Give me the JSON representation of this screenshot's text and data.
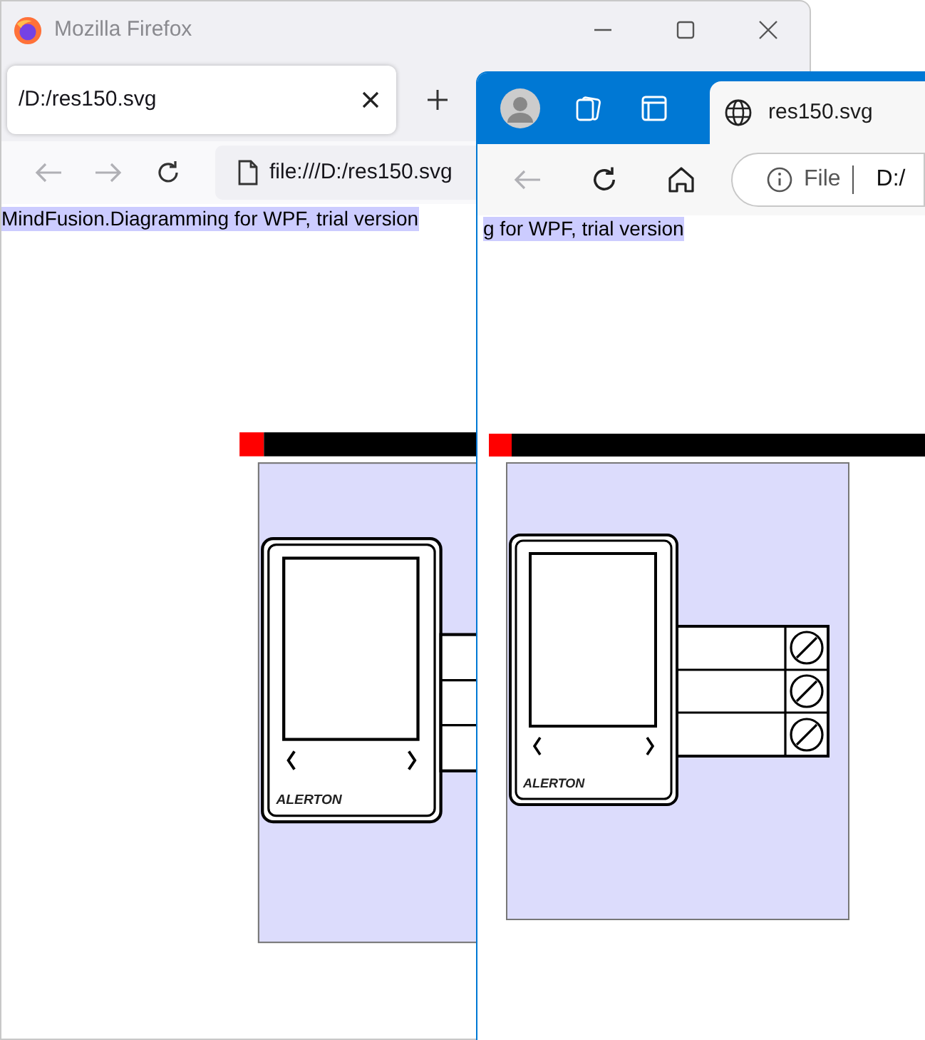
{
  "firefox": {
    "title": "Mozilla Firefox",
    "tabs": [
      {
        "label": "/D:/res150.svg",
        "selected": true
      }
    ],
    "back_disabled": true,
    "forward_disabled": true,
    "address": "file:///D:/res150.svg",
    "banner": "MindFusion.Diagramming for WPF, trial version",
    "device_logo": "ALERTON"
  },
  "edge": {
    "tabs": [
      {
        "label": "res150.svg",
        "selected": true
      }
    ],
    "back_disabled": true,
    "address_scheme": "File",
    "address": "D:/",
    "banner": "g for WPF, trial version",
    "device_logo": "ALERTON"
  }
}
